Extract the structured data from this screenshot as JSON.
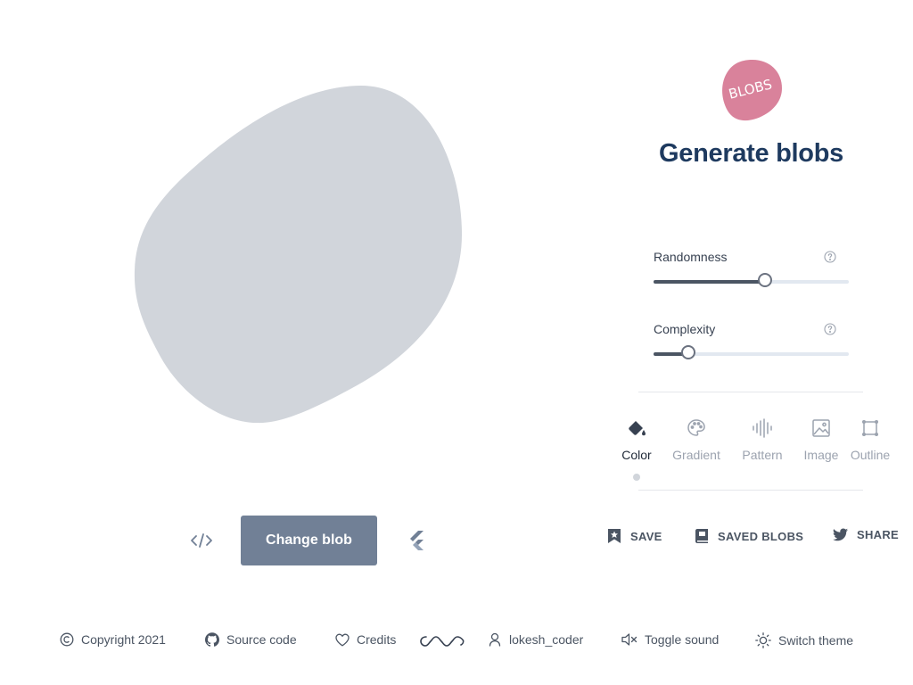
{
  "app": {
    "logo_text": "BLOBS",
    "title": "Generate blobs"
  },
  "blob": {
    "fill_color": "#d1d5db"
  },
  "canvas_controls": {
    "change_blob_label": "Change blob",
    "code_icon": "code-icon",
    "flutter_icon": "flutter-icon"
  },
  "sliders": [
    {
      "label": "Randomness",
      "value": 0.57,
      "help_icon": "question-circle-icon"
    },
    {
      "label": "Complexity",
      "value": 0.18,
      "help_icon": "question-circle-icon"
    }
  ],
  "tabs": [
    {
      "label": "Color",
      "icon": "paint-bucket-icon",
      "active": true
    },
    {
      "label": "Gradient",
      "icon": "palette-icon",
      "active": false
    },
    {
      "label": "Pattern",
      "icon": "waveform-icon",
      "active": false
    },
    {
      "label": "Image",
      "icon": "image-icon",
      "active": false
    },
    {
      "label": "Outline",
      "icon": "outline-icon",
      "active": false
    }
  ],
  "actions": {
    "save": "SAVE",
    "saved_blobs": "SAVED BLOBS",
    "share": "SHARE"
  },
  "footer": {
    "copyright": "Copyright 2021",
    "source_code": "Source code",
    "credits": "Credits",
    "author": "lokesh_coder",
    "toggle_sound": "Toggle sound",
    "switch_theme": "Switch theme"
  },
  "colors": {
    "accent": "#718096",
    "logo": "#d9829b",
    "title": "#1e3a5f"
  }
}
